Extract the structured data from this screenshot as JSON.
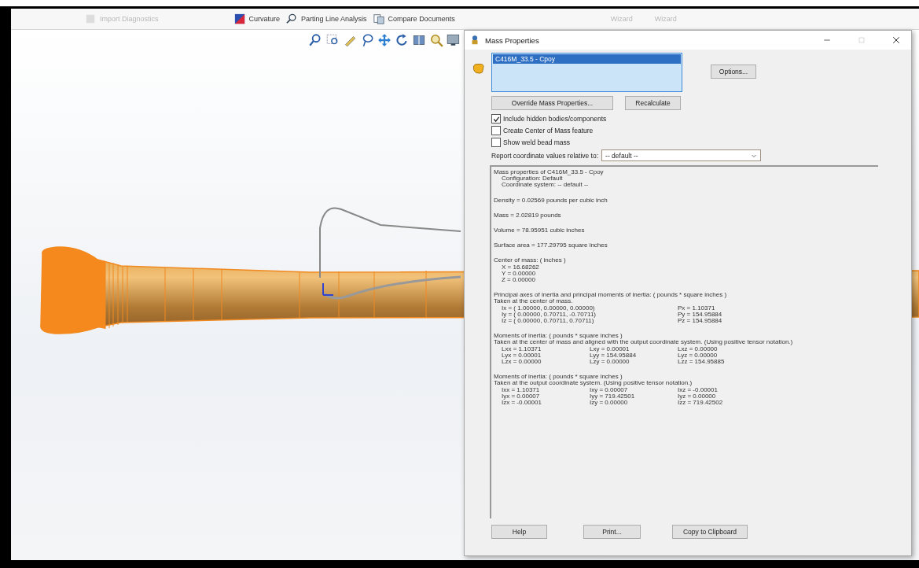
{
  "toolbar": {
    "items": [
      {
        "label": "Import Diagnostics",
        "disabled": true
      },
      {
        "label": "Curvature",
        "disabled": false
      },
      {
        "label": "Parting Line Analysis",
        "disabled": false
      },
      {
        "label": "Compare Documents",
        "disabled": false
      },
      {
        "label": "Wizard",
        "disabled": true
      },
      {
        "label": "Wizard",
        "disabled": true
      }
    ]
  },
  "dialog": {
    "title": "Mass Properties",
    "selection_list": [
      {
        "label": "C416M_33.5 - Cpoy",
        "selected": true
      }
    ],
    "options_button": "Options...",
    "override_button": "Override Mass Properties...",
    "recalculate_button": "Recalculate",
    "checkboxes": [
      {
        "label": "Include hidden bodies/components",
        "checked": true
      },
      {
        "label": "Create Center of Mass feature",
        "checked": false
      },
      {
        "label": "Show weld bead mass",
        "checked": false
      }
    ],
    "coordinate_label": "Report coordinate values relative to:",
    "coordinate_value": "-- default --",
    "report": [
      {
        "kind": "text",
        "lines": [
          "Mass properties of C416M_33.5 - Cpoy"
        ],
        "children": [
          "Configuration: Default",
          "Coordinate system: -- default --"
        ]
      },
      {
        "kind": "text",
        "lines": [
          "Density = 0.02569 pounds per cubic inch"
        ]
      },
      {
        "kind": "text",
        "lines": [
          "Mass = 2.02819 pounds"
        ]
      },
      {
        "kind": "text",
        "lines": [
          "Volume = 78.95951 cubic inches"
        ]
      },
      {
        "kind": "text",
        "lines": [
          "Surface area = 177.29795 square inches"
        ]
      },
      {
        "kind": "text",
        "lines": [
          "Center of mass: ( inches )"
        ],
        "children": [
          "X = 16.68262",
          "Y = 0.00000",
          "Z = 0.00000"
        ]
      },
      {
        "kind": "grid",
        "lines": [
          "Principal axes of inertia and principal moments of inertia: ( pounds * square inches )",
          "Taken at the center of mass."
        ],
        "rows": [
          [
            "Ix = ( 1.00000,  0.00000,  0.00000)",
            "Px = 1.10371"
          ],
          [
            "Iy = ( 0.00000,  0.70711, -0.70711)",
            "Py = 154.95884"
          ],
          [
            "Iz = ( 0.00000,  0.70711,  0.70711)",
            "Pz = 154.95884"
          ]
        ]
      },
      {
        "kind": "grid",
        "lines": [
          "Moments of inertia: ( pounds * square inches )",
          "Taken at the center of mass and aligned with the output coordinate system. (Using positive tensor notation.)"
        ],
        "rows": [
          [
            "Lxx = 1.10371",
            "Lxy = 0.00001",
            "Lxz = 0.00000"
          ],
          [
            "Lyx = 0.00001",
            "Lyy = 154.95884",
            "Lyz = 0.00000"
          ],
          [
            "Lzx = 0.00000",
            "Lzy = 0.00000",
            "Lzz = 154.95885"
          ]
        ]
      },
      {
        "kind": "grid",
        "lines": [
          "Moments of inertia: ( pounds * square inches )",
          "Taken at the output coordinate system. (Using positive tensor notation.)"
        ],
        "rows": [
          [
            "Ixx = 1.10371",
            "Ixy = 0.00007",
            "Ixz = -0.00001"
          ],
          [
            "Iyx = 0.00007",
            "Iyy = 719.42501",
            "Iyz = 0.00000"
          ],
          [
            "Izx = -0.00001",
            "Izy = 0.00000",
            "Izz = 719.42502"
          ]
        ]
      }
    ],
    "bottom_buttons": [
      "Help",
      "Print...",
      "Copy to Clipboard"
    ]
  }
}
